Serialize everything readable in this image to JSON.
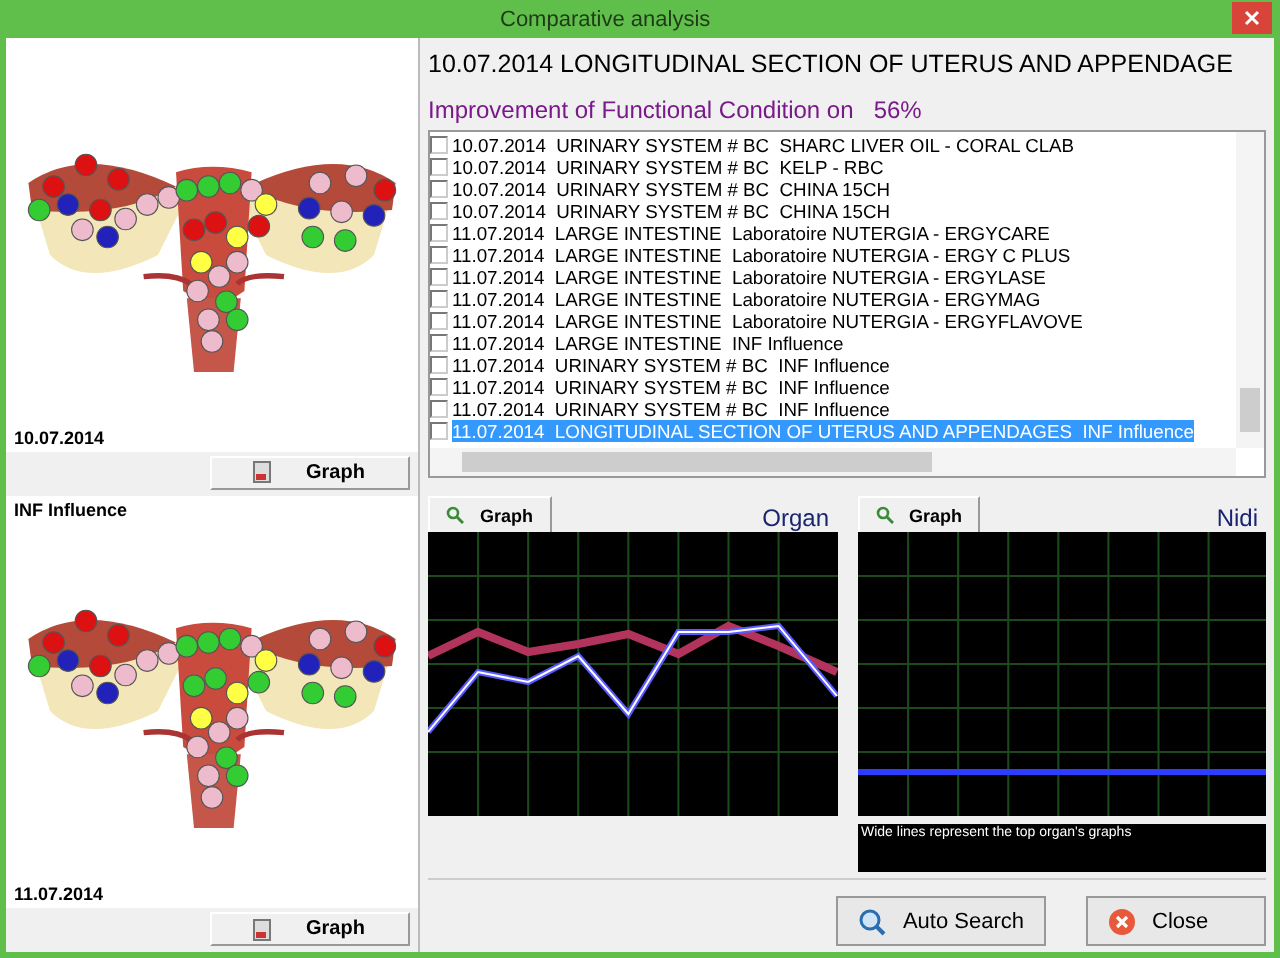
{
  "window": {
    "title": "Comparative analysis"
  },
  "left_panels": [
    {
      "date": "10.07.2014",
      "button": "Graph"
    },
    {
      "caption": "INF Influence",
      "date": "11.07.2014",
      "button": "Graph"
    }
  ],
  "header": {
    "title": "10.07.2014 LONGITUDINAL SECTION OF UTERUS AND APPENDAGE",
    "improvement_label": "Improvement of Functional Condition on",
    "improvement_value": "56%"
  },
  "list": {
    "items": [
      {
        "text": "10.07.2014  URINARY SYSTEM # BC  SHARC LIVER OIL - CORAL CLAB",
        "checked": false,
        "selected": false
      },
      {
        "text": "10.07.2014  URINARY SYSTEM # BC  KELP - RBC",
        "checked": false,
        "selected": false
      },
      {
        "text": "10.07.2014  URINARY SYSTEM # BC  CHINA 15CH",
        "checked": false,
        "selected": false
      },
      {
        "text": "10.07.2014  URINARY SYSTEM # BC  CHINA 15CH",
        "checked": false,
        "selected": false
      },
      {
        "text": "11.07.2014  LARGE INTESTINE  Laboratoire NUTERGIA - ERGYCARE",
        "checked": false,
        "selected": false
      },
      {
        "text": "11.07.2014  LARGE INTESTINE  Laboratoire NUTERGIA - ERGY C PLUS",
        "checked": false,
        "selected": false
      },
      {
        "text": "11.07.2014  LARGE INTESTINE  Laboratoire NUTERGIA - ERGYLASE",
        "checked": false,
        "selected": false
      },
      {
        "text": "11.07.2014  LARGE INTESTINE  Laboratoire NUTERGIA - ERGYMAG",
        "checked": false,
        "selected": false
      },
      {
        "text": "11.07.2014  LARGE INTESTINE  Laboratoire NUTERGIA - ERGYFLAVOVE",
        "checked": false,
        "selected": false
      },
      {
        "text": "11.07.2014  LARGE INTESTINE  INF Influence",
        "checked": false,
        "selected": false
      },
      {
        "text": "11.07.2014  URINARY SYSTEM # BC  INF Influence",
        "checked": false,
        "selected": false
      },
      {
        "text": "11.07.2014  URINARY SYSTEM # BC  INF Influence",
        "checked": false,
        "selected": false
      },
      {
        "text": "11.07.2014  URINARY SYSTEM # BC  INF Influence",
        "checked": false,
        "selected": false
      },
      {
        "text": "11.07.2014  LONGITUDINAL SECTION OF UTERUS AND APPENDAGES  INF Influence",
        "checked": false,
        "selected": true
      }
    ]
  },
  "charts": [
    {
      "kind": "organ",
      "button": "Graph",
      "title": "Organ"
    },
    {
      "kind": "nidi",
      "button": "Graph",
      "title": "Nidi"
    }
  ],
  "legend": "Wide lines represent the top organ's graphs",
  "buttons": [
    {
      "kind": "search",
      "label": "Auto Search"
    },
    {
      "kind": "close",
      "label": "Close"
    }
  ]
}
